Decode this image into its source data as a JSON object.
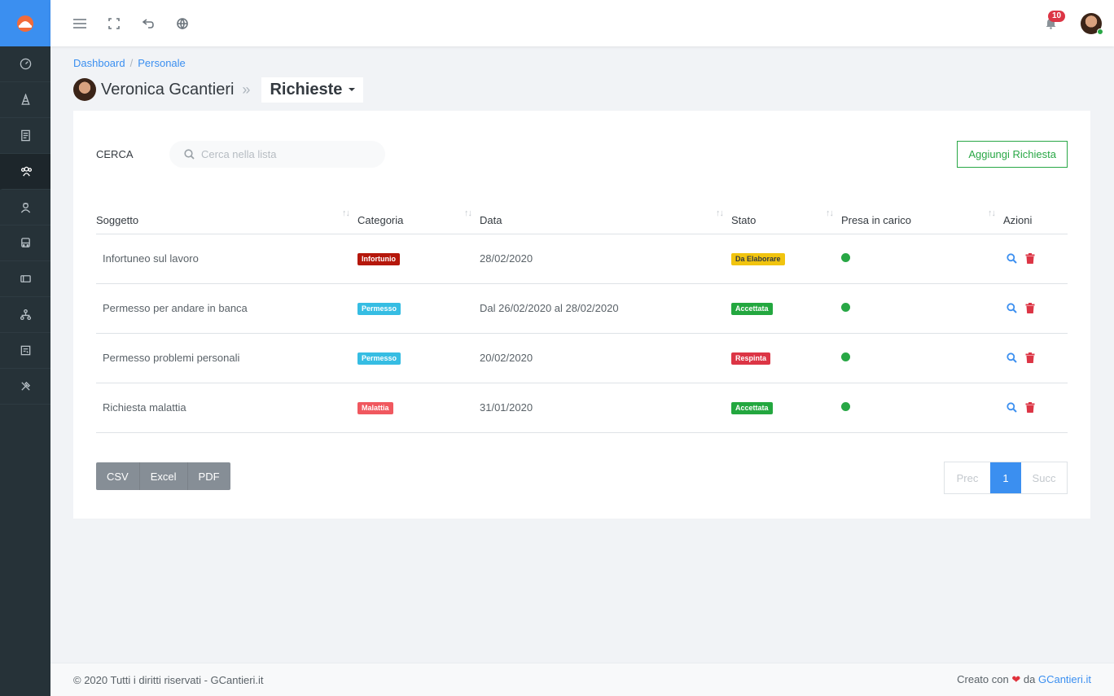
{
  "topbar": {
    "notification_count": "10"
  },
  "breadcrumb": {
    "dashboard": "Dashboard",
    "separator": "/",
    "personale": "Personale"
  },
  "header": {
    "person_name": "Veronica Gcantieri",
    "separator": "»",
    "section": "Richieste"
  },
  "search": {
    "label": "CERCA",
    "placeholder": "Cerca nella lista"
  },
  "add_button": "Aggiungi Richiesta",
  "table": {
    "columns": [
      "Soggetto",
      "Categoria",
      "Data",
      "Stato",
      "Presa in carico",
      "Azioni"
    ],
    "rows": [
      {
        "subject": "Infortuneo sul lavoro",
        "category": "Infortunio",
        "category_color": "#b5170b",
        "date": "28/02/2020",
        "status": "Da Elaborare",
        "status_color": "#f1c40f",
        "status_text_color": "#343a40",
        "taken_color": "#28a745"
      },
      {
        "subject": "Permesso per andare in banca",
        "category": "Permesso",
        "category_color": "#36bde3",
        "date": "Dal 26/02/2020 al 28/02/2020",
        "status": "Accettata",
        "status_color": "#23a73f",
        "status_text_color": "#ffffff",
        "taken_color": "#28a745"
      },
      {
        "subject": "Permesso problemi personali",
        "category": "Permesso",
        "category_color": "#36bde3",
        "date": "20/02/2020",
        "status": "Respinta",
        "status_color": "#dc3545",
        "status_text_color": "#ffffff",
        "taken_color": "#28a745"
      },
      {
        "subject": "Richiesta malattia",
        "category": "Malattia",
        "category_color": "#f0585f",
        "date": "31/01/2020",
        "status": "Accettata",
        "status_color": "#23a73f",
        "status_text_color": "#ffffff",
        "taken_color": "#28a745"
      }
    ]
  },
  "export": {
    "csv": "CSV",
    "excel": "Excel",
    "pdf": "PDF"
  },
  "pagination": {
    "prev": "Prec",
    "current": "1",
    "next": "Succ"
  },
  "footer": {
    "copyright": "© 2020 Tutti i diritti riservati - GCantieri.it",
    "created_with": "Creato con",
    "by": "da",
    "link": "GCantieri.it"
  },
  "colors": {
    "accent": "#3b8ff0",
    "sidebar": "#263238",
    "success": "#28a745",
    "danger": "#dc3545"
  }
}
